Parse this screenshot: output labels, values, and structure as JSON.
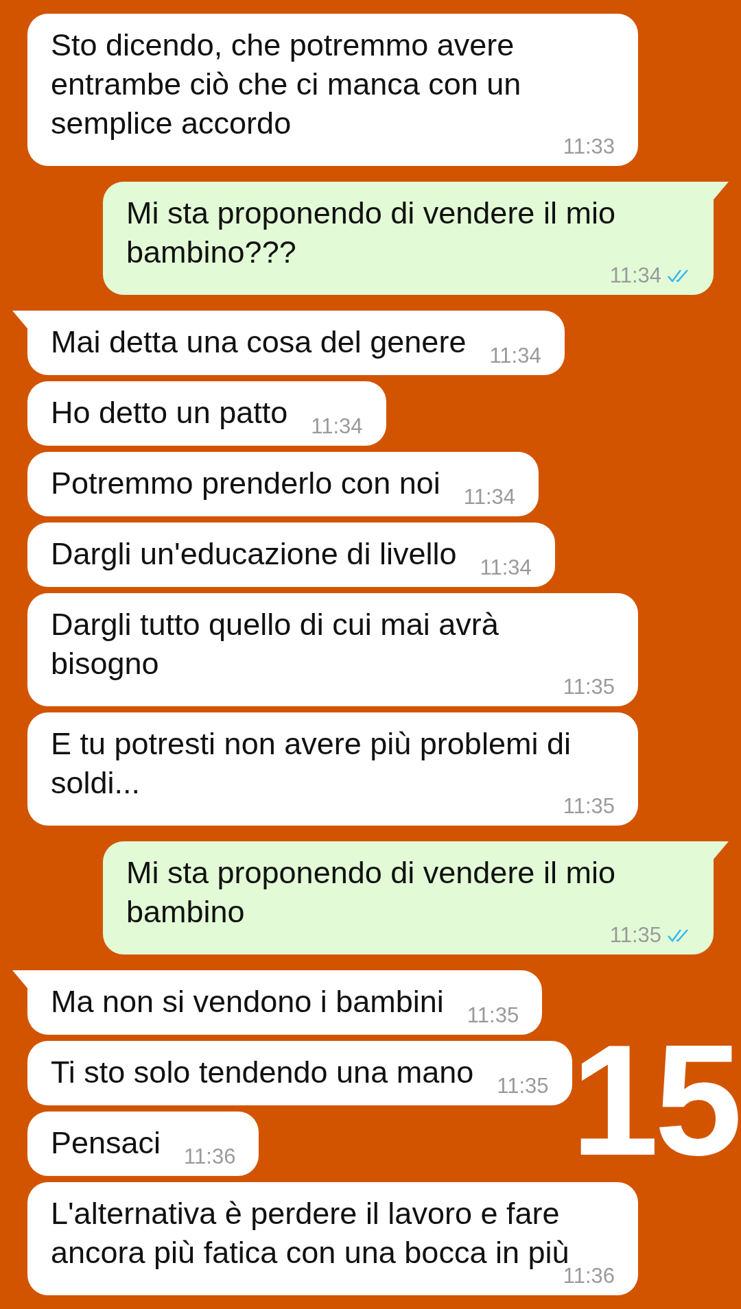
{
  "messages": [
    {
      "kind": "incoming",
      "tail": false,
      "text": "Sto dicendo, che potremmo avere entrambe ciò che ci manca con un semplice accordo",
      "time": "11:33"
    },
    {
      "kind": "outgoing",
      "tail": true,
      "text": "Mi sta proponendo di vendere il mio bambino???",
      "time": "11:34",
      "read": true
    },
    {
      "kind": "incoming",
      "tail": true,
      "text": "Mai detta una cosa del genere",
      "time": "11:34"
    },
    {
      "kind": "incoming",
      "tail": false,
      "text": "Ho detto un patto",
      "time": "11:34"
    },
    {
      "kind": "incoming",
      "tail": false,
      "text": "Potremmo prenderlo con noi",
      "time": "11:34"
    },
    {
      "kind": "incoming",
      "tail": false,
      "text": "Dargli un'educazione di livello",
      "time": "11:34"
    },
    {
      "kind": "incoming",
      "tail": false,
      "text": "Dargli tutto quello di cui mai avrà bisogno",
      "time": "11:35"
    },
    {
      "kind": "incoming",
      "tail": false,
      "text": "E tu potresti non avere più problemi di soldi...",
      "time": "11:35"
    },
    {
      "kind": "outgoing",
      "tail": true,
      "text": "Mi sta proponendo di vendere il mio bambino",
      "time": "11:35",
      "read": true
    },
    {
      "kind": "incoming",
      "tail": true,
      "text": "Ma non si vendono i bambini",
      "time": "11:35"
    },
    {
      "kind": "incoming",
      "tail": false,
      "text": "Ti sto solo tendendo una mano",
      "time": "11:35"
    },
    {
      "kind": "incoming",
      "tail": false,
      "text": "Pensaci",
      "time": "11:36"
    },
    {
      "kind": "incoming",
      "tail": false,
      "text": "L'alternativa è perdere il lavoro e fare ancora più fatica con una bocca in più",
      "time": "11:36"
    }
  ],
  "overlay_number": "15"
}
